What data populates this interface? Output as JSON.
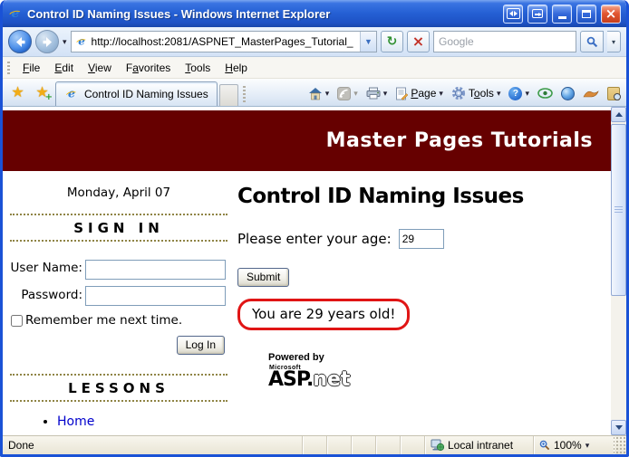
{
  "titlebar": {
    "title": "Control ID Naming Issues - Windows Internet Explorer"
  },
  "nav": {
    "url": "http://localhost:2081/ASPNET_MasterPages_Tutorial_",
    "search_placeholder": "Google"
  },
  "menu": {
    "items": [
      {
        "pre": "",
        "key": "F",
        "post": "ile"
      },
      {
        "pre": "",
        "key": "E",
        "post": "dit"
      },
      {
        "pre": "",
        "key": "V",
        "post": "iew"
      },
      {
        "pre": "F",
        "key": "a",
        "post": "vorites"
      },
      {
        "pre": "",
        "key": "T",
        "post": "ools"
      },
      {
        "pre": "",
        "key": "H",
        "post": "elp"
      }
    ]
  },
  "tabs": {
    "active_label": "Control ID Naming Issues"
  },
  "commandbar": {
    "page": {
      "pre": "",
      "key": "P",
      "post": "age"
    },
    "tools": {
      "pre": "T",
      "key": "o",
      "post": "ols"
    },
    "help_glyph": "?"
  },
  "icons": {
    "star": "★",
    "caret_down": "▾",
    "refresh": "↻",
    "stop": "×",
    "close": "×"
  },
  "page": {
    "banner_title": "Master Pages Tutorials",
    "sidebar": {
      "date": "Monday, April 07",
      "signin_heading": "SIGN IN",
      "username_label": "User Name:",
      "password_label": "Password:",
      "remember_label": "Remember me next time.",
      "login_button": "Log In",
      "lessons_heading": "LESSONS",
      "home_link": "Home"
    },
    "main": {
      "heading": "Control ID Naming Issues",
      "age_prompt": "Please enter your age:",
      "age_value": "29",
      "submit_button": "Submit",
      "result_text": "You are 29 years old!",
      "powered_by": "Powered by",
      "logo_microsoft": "Microsoft",
      "logo_asp": "ASP.",
      "logo_net": "net"
    }
  },
  "statusbar": {
    "status": "Done",
    "zone": "Local intranet",
    "zoom_level": "100%"
  },
  "colors": {
    "banner_bg": "#660000",
    "annotation_red": "#e01515",
    "link_blue": "#0000cc",
    "titlebar_blue": "#2560d4"
  }
}
